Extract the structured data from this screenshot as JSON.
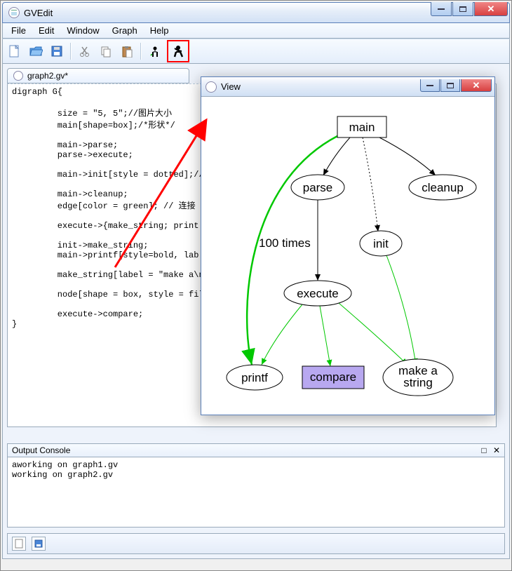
{
  "window": {
    "title": "GVEdit"
  },
  "menu": {
    "file": "File",
    "edit": "Edit",
    "window": "Window",
    "graph": "Graph",
    "help": "Help"
  },
  "editor": {
    "tab": "graph2.gv*",
    "code": "digraph G{\n\n         size = \"5, 5\";//图片大小\n         main[shape=box];/*形状*/\n\n         main->parse;\n         parse->execute;\n\n         main->init[style = dotted];//\n\n         main->cleanup;\n         edge[color = green]; // 连接\n\n         execute->{make_string; print\n\n         init->make_string;\n         main->printf[style=bold, lab\n\n         make_string[label = \"make a\\n\n\n         node[shape = box, style = fil\n\n         execute->compare;\n}"
  },
  "view": {
    "title": "View",
    "nodes": {
      "main": "main",
      "parse": "parse",
      "cleanup": "cleanup",
      "init": "init",
      "execute": "execute",
      "printf": "printf",
      "compare": "compare",
      "make_string": "make a\nstring"
    },
    "edge_label": "100 times"
  },
  "console": {
    "title": "Output Console",
    "lines": "aworking on graph1.gv\nworking on graph2.gv"
  },
  "chart_data": {
    "type": "diagram-graph",
    "directed": true,
    "nodes": [
      {
        "id": "main",
        "label": "main",
        "shape": "box"
      },
      {
        "id": "parse",
        "label": "parse",
        "shape": "ellipse"
      },
      {
        "id": "cleanup",
        "label": "cleanup",
        "shape": "ellipse"
      },
      {
        "id": "init",
        "label": "init",
        "shape": "ellipse"
      },
      {
        "id": "execute",
        "label": "execute",
        "shape": "ellipse"
      },
      {
        "id": "printf",
        "label": "printf",
        "shape": "ellipse"
      },
      {
        "id": "compare",
        "label": "compare",
        "shape": "box",
        "fill": "#b8a8f0"
      },
      {
        "id": "make_string",
        "label": "make a\\nstring",
        "shape": "ellipse"
      }
    ],
    "edges": [
      {
        "from": "main",
        "to": "parse",
        "color": "#000"
      },
      {
        "from": "main",
        "to": "cleanup",
        "color": "#000"
      },
      {
        "from": "main",
        "to": "init",
        "color": "#000",
        "style": "dotted"
      },
      {
        "from": "parse",
        "to": "execute",
        "color": "#000",
        "label": "100 times"
      },
      {
        "from": "main",
        "to": "printf",
        "color": "#00c800",
        "style": "bold"
      },
      {
        "from": "init",
        "to": "make_string",
        "color": "#00c800"
      },
      {
        "from": "execute",
        "to": "printf",
        "color": "#00c800"
      },
      {
        "from": "execute",
        "to": "compare",
        "color": "#00c800"
      },
      {
        "from": "execute",
        "to": "make_string",
        "color": "#00c800"
      }
    ]
  }
}
